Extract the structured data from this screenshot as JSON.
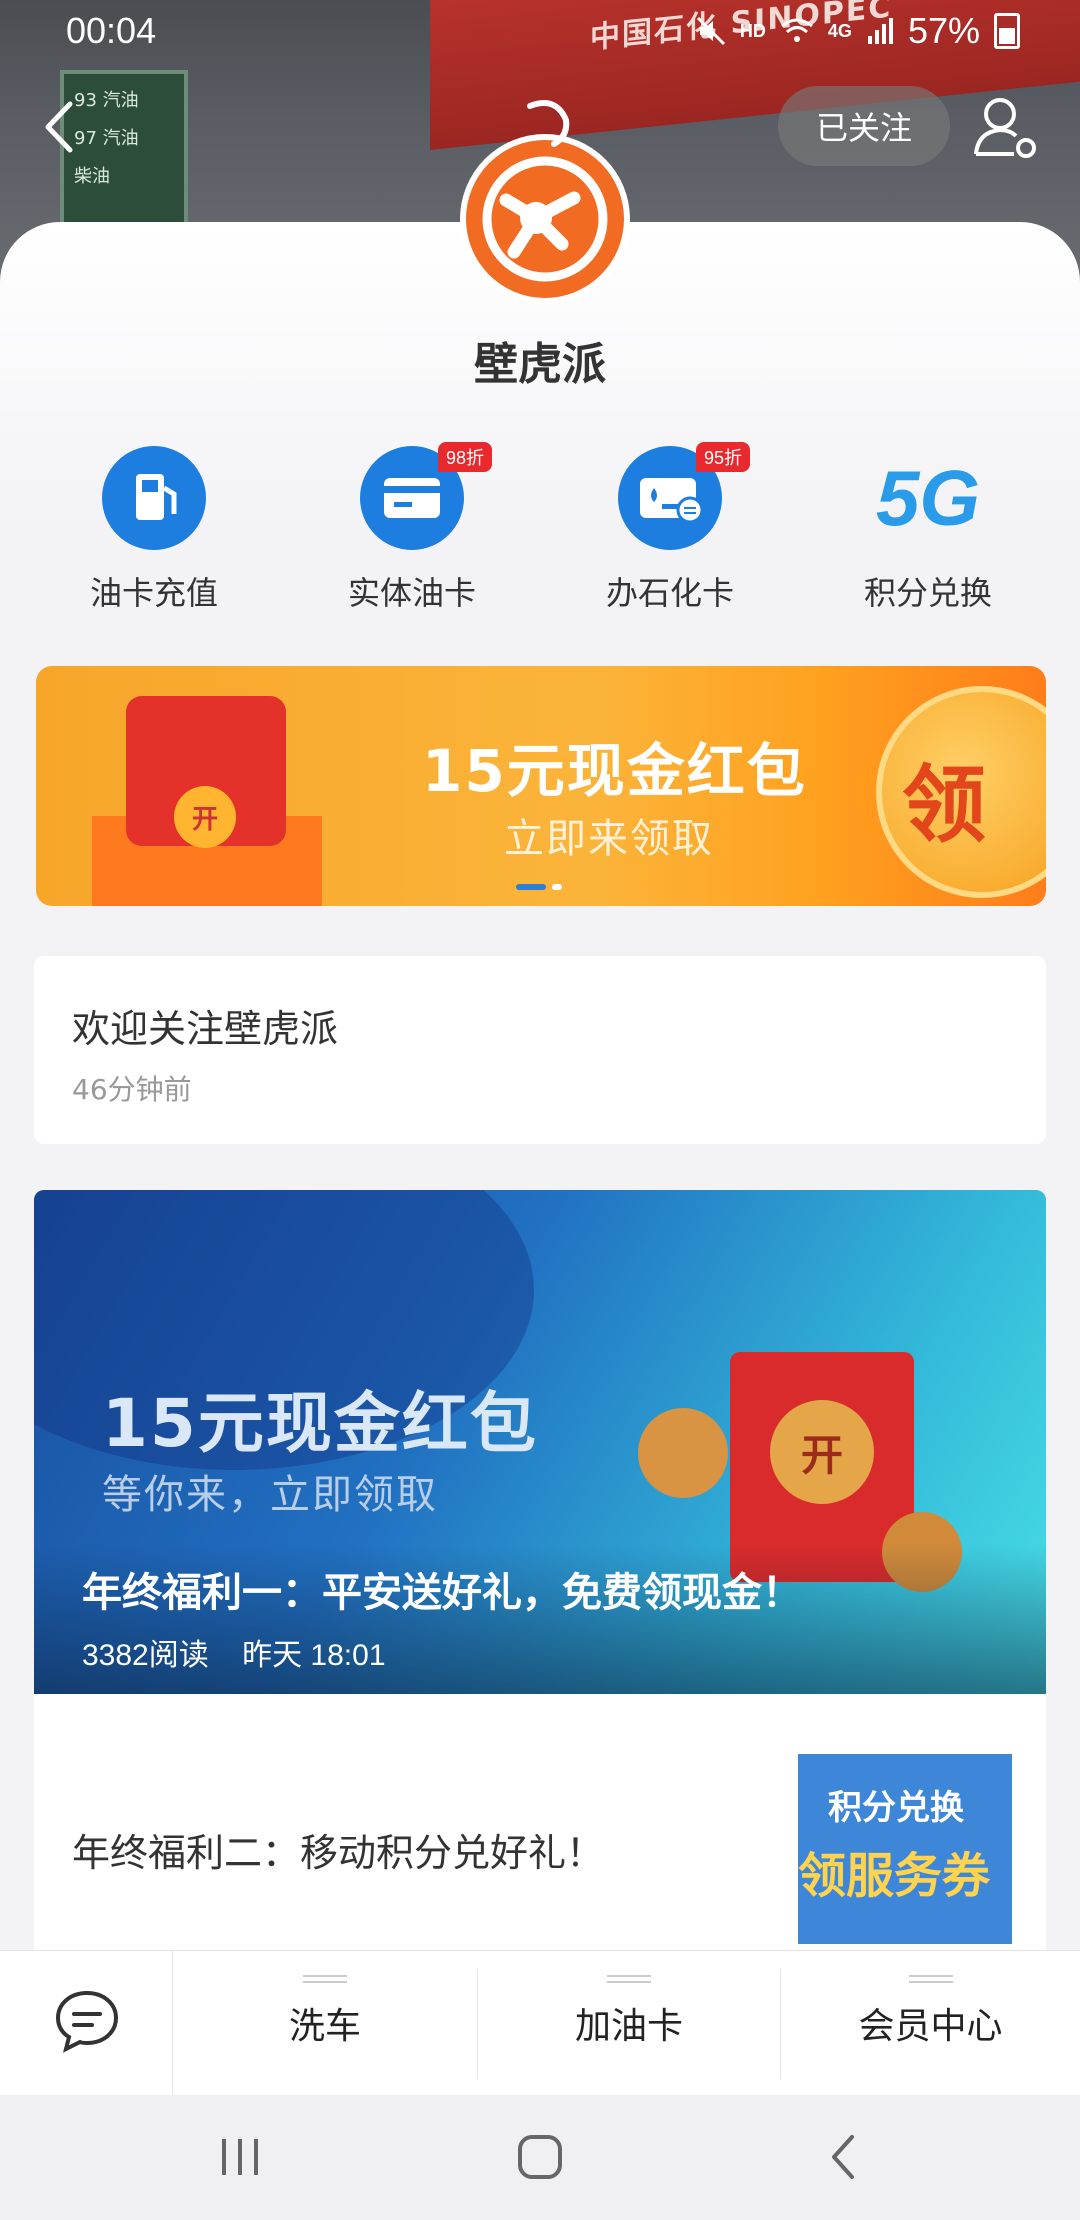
{
  "status_bar": {
    "time": "00:04",
    "net": "HD",
    "signal": "4G",
    "battery": "57%"
  },
  "header": {
    "follow_label": "已关注"
  },
  "hero_scene": {
    "station_text": "中国石化 SINOPEC",
    "price_sign": [
      "93 汽油",
      "97 汽油",
      "柴油"
    ]
  },
  "account": {
    "name": "壁虎派"
  },
  "quick_actions": [
    {
      "label": "油卡充值",
      "icon": "fuel-pump-icon",
      "badge": ""
    },
    {
      "label": "实体油卡",
      "icon": "card-icon",
      "badge": "98折"
    },
    {
      "label": "办石化卡",
      "icon": "petro-card-icon",
      "badge": "95折"
    },
    {
      "label": "积分兑换",
      "icon": "5g-icon",
      "badge": ""
    }
  ],
  "banner": {
    "title": "15元现金红包",
    "subtitle": "立即来领取",
    "coin_text": "领",
    "seal": "开"
  },
  "message": {
    "title": "欢迎关注壁虎派",
    "time": "46分钟前"
  },
  "article_main": {
    "hero_title": "15元现金红包",
    "hero_subtitle": "等你来，立即领取",
    "seal": "开",
    "title": "年终福利一：平安送好礼，免费领现金！",
    "reads": "3382阅读",
    "date": "昨天 18:01"
  },
  "article_second": {
    "title": "年终福利二：移动积分兑好礼！",
    "thumb_line1": "积分兑换",
    "thumb_line2": "领服务券"
  },
  "bottom_menu": [
    {
      "label": "洗车"
    },
    {
      "label": "加油卡"
    },
    {
      "label": "会员中心"
    }
  ],
  "colors": {
    "brand_orange": "#f26b23",
    "accent_blue": "#1d7ee0",
    "badge_red": "#e8292d"
  }
}
